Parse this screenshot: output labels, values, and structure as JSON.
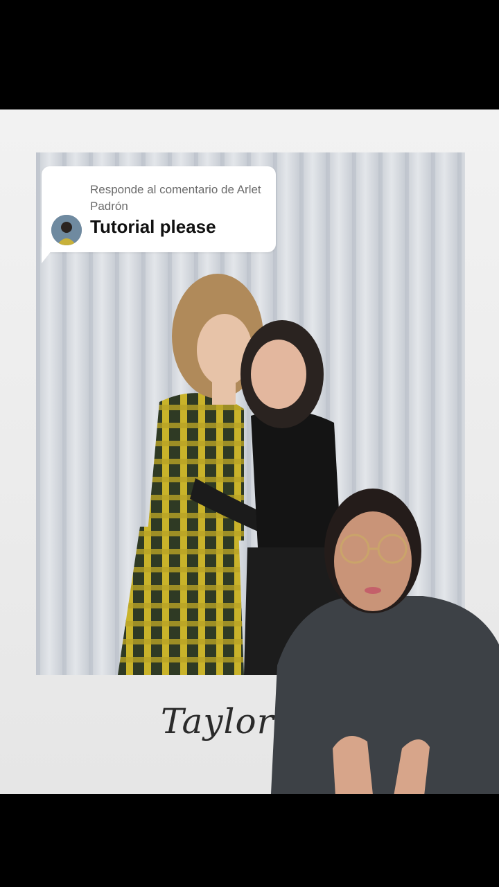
{
  "reply_bubble": {
    "label": "Responde al comentario de Arlet Padrón",
    "comment": "Tutorial please",
    "avatar_icon": "user-avatar"
  },
  "polaroid": {
    "caption": "Taylor &"
  },
  "colors": {
    "frame": "#eeeeee",
    "bubble": "#ffffff",
    "comment_text": "#111111",
    "label_text": "#6b6b6b"
  }
}
